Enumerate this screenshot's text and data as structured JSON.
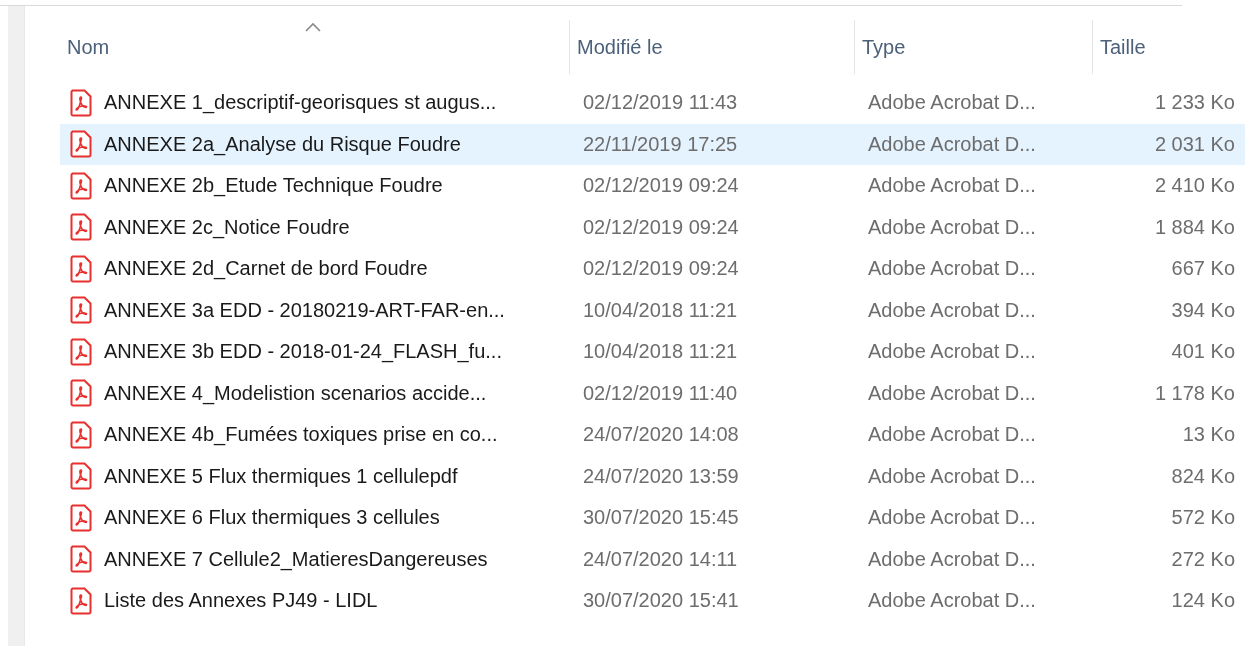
{
  "columns": [
    {
      "label": "Nom",
      "sorted": true
    },
    {
      "label": "Modifié le",
      "sorted": false
    },
    {
      "label": "Type",
      "sorted": false
    },
    {
      "label": "Taille",
      "sorted": false
    }
  ],
  "rows": [
    {
      "name": "ANNEXE 1_descriptif-georisques st augus...",
      "modified": "02/12/2019 11:43",
      "type": "Adobe Acrobat D...",
      "size": "1 233 Ko",
      "selected": false
    },
    {
      "name": "ANNEXE 2a_Analyse du Risque Foudre",
      "modified": "22/11/2019 17:25",
      "type": "Adobe Acrobat D...",
      "size": "2 031 Ko",
      "selected": true
    },
    {
      "name": "ANNEXE 2b_Etude Technique Foudre",
      "modified": "02/12/2019 09:24",
      "type": "Adobe Acrobat D...",
      "size": "2 410 Ko",
      "selected": false
    },
    {
      "name": "ANNEXE 2c_Notice Foudre",
      "modified": "02/12/2019 09:24",
      "type": "Adobe Acrobat D...",
      "size": "1 884 Ko",
      "selected": false
    },
    {
      "name": "ANNEXE 2d_Carnet de bord Foudre",
      "modified": "02/12/2019 09:24",
      "type": "Adobe Acrobat D...",
      "size": "667 Ko",
      "selected": false
    },
    {
      "name": "ANNEXE 3a EDD  - 20180219-ART-FAR-en...",
      "modified": "10/04/2018 11:21",
      "type": "Adobe Acrobat D...",
      "size": "394 Ko",
      "selected": false
    },
    {
      "name": "ANNEXE 3b EDD - 2018-01-24_FLASH_fu...",
      "modified": "10/04/2018 11:21",
      "type": "Adobe Acrobat D...",
      "size": "401 Ko",
      "selected": false
    },
    {
      "name": "ANNEXE 4_Modelistion scenarios accide...",
      "modified": "02/12/2019 11:40",
      "type": "Adobe Acrobat D...",
      "size": "1 178 Ko",
      "selected": false
    },
    {
      "name": "ANNEXE 4b_Fumées toxiques prise en co...",
      "modified": "24/07/2020 14:08",
      "type": "Adobe Acrobat D...",
      "size": "13 Ko",
      "selected": false
    },
    {
      "name": "ANNEXE 5 Flux thermiques 1 cellulepdf",
      "modified": "24/07/2020 13:59",
      "type": "Adobe Acrobat D...",
      "size": "824 Ko",
      "selected": false
    },
    {
      "name": "ANNEXE 6 Flux thermiques 3 cellules",
      "modified": "30/07/2020 15:45",
      "type": "Adobe Acrobat D...",
      "size": "572 Ko",
      "selected": false
    },
    {
      "name": "ANNEXE 7 Cellule2_MatieresDangereuses",
      "modified": "24/07/2020 14:11",
      "type": "Adobe Acrobat D...",
      "size": "272 Ko",
      "selected": false
    },
    {
      "name": "Liste des Annexes PJ49 - LIDL",
      "modified": "30/07/2020 15:41",
      "type": "Adobe Acrobat D...",
      "size": "124 Ko",
      "selected": false
    }
  ]
}
